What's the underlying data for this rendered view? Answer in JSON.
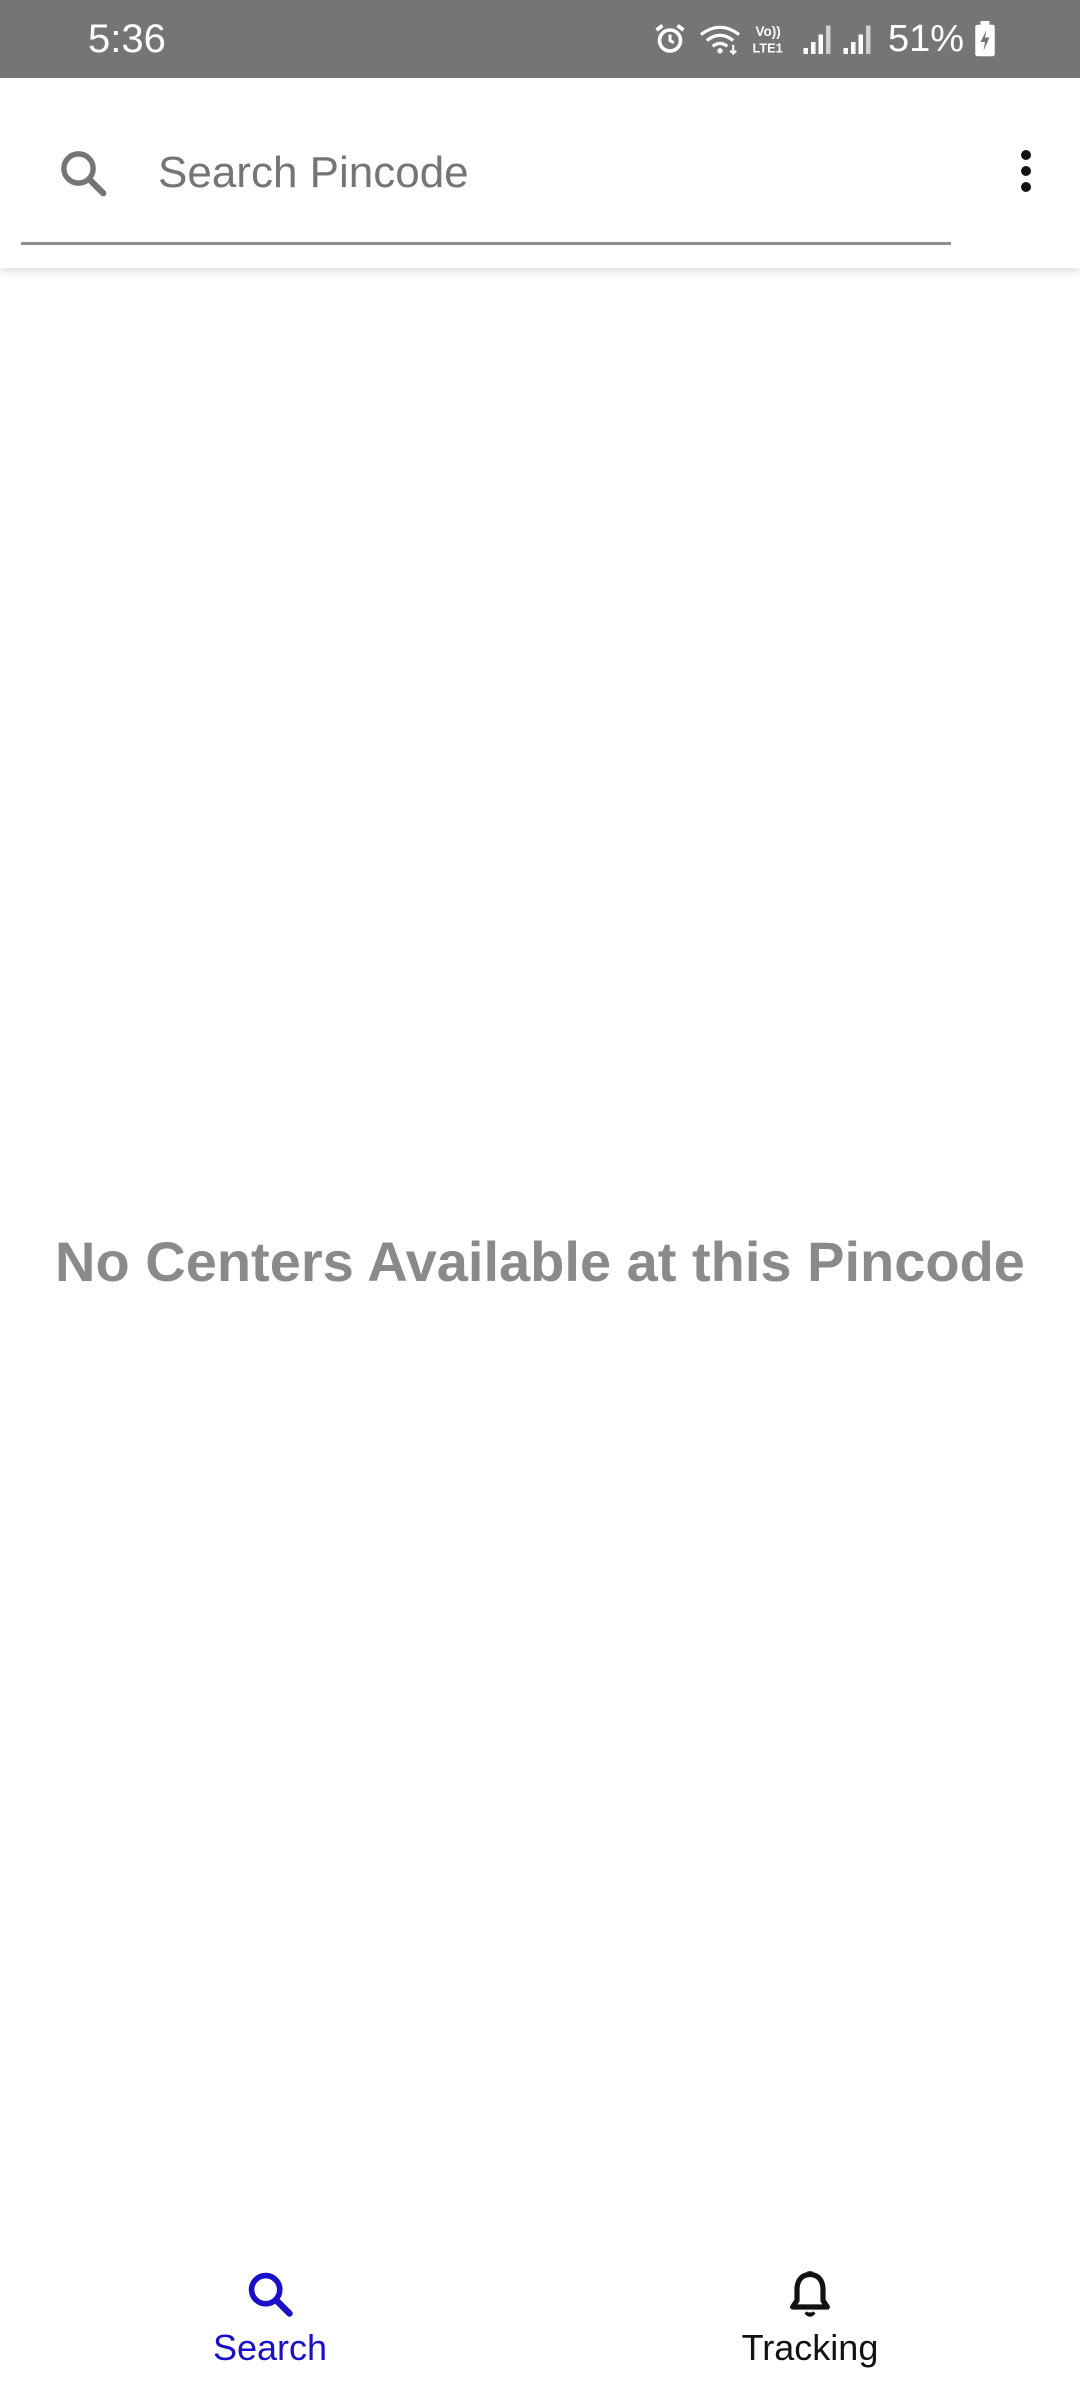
{
  "status_bar": {
    "time": "5:36",
    "battery": "51%",
    "icons": [
      "alarm-icon",
      "wifi-icon",
      "volte-icon",
      "signal-icon",
      "signal-icon",
      "battery-charging-icon"
    ],
    "volte_top": "Vo))",
    "volte_bottom": "LTE1"
  },
  "search": {
    "placeholder": "Search Pincode",
    "value": "",
    "icon": "search-icon",
    "menu_icon": "more-vert-icon"
  },
  "main": {
    "empty_message": "No Centers Available at this Pincode"
  },
  "bottom_nav": {
    "items": [
      {
        "label": "Search",
        "icon": "search-icon",
        "active": true
      },
      {
        "label": "Tracking",
        "icon": "bell-icon",
        "active": false
      }
    ],
    "active_color": "#1a10c8",
    "inactive_color": "#111111"
  },
  "colors": {
    "status_bar": "#757575",
    "empty_text": "#8a8a8a"
  }
}
